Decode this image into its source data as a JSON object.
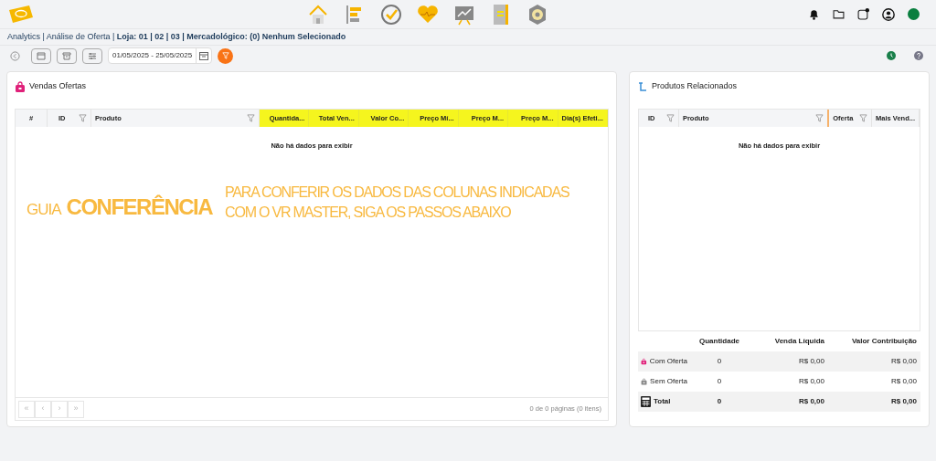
{
  "breadcrumb": "Analytics | Análise de Oferta | **Loja: 01 | 02 | 03 | Mercadológico: (0) Nenhum Selecionado**",
  "toolbar": {
    "date_range": "01/05/2025 - 25/05/2025"
  },
  "sales_panel": {
    "title": "Vendas Ofertas",
    "columns": [
      {
        "label": "#",
        "filter": false,
        "highlighted": false
      },
      {
        "label": "ID",
        "filter": true,
        "highlighted": false
      },
      {
        "label": "Produto",
        "filter": true,
        "highlighted": false
      },
      {
        "label": "Quantida...",
        "filter": false,
        "highlighted": true
      },
      {
        "label": "Total Ven...",
        "filter": false,
        "highlighted": true
      },
      {
        "label": "Valor Co...",
        "filter": false,
        "highlighted": true
      },
      {
        "label": "Preço Mí...",
        "filter": false,
        "highlighted": true
      },
      {
        "label": "Preço M...",
        "filter": false,
        "highlighted": true
      },
      {
        "label": "Preço M...",
        "filter": false,
        "highlighted": true
      },
      {
        "label": "Dia(s) Efeti...",
        "filter": false,
        "highlighted": true
      }
    ],
    "empty_message": "Não há dados para exibir",
    "guide": {
      "small": "GUIA",
      "big": "CONFERÊNCIA",
      "line_1": "PARA CONFERIR  OS DADOS DAS COLUNAS INDICADAS",
      "line_2": "COM O VR MASTER, SIGA OS PASSOS ABAIXO"
    },
    "pager": [
      "«",
      "‹",
      "›",
      "»"
    ],
    "page_info": "0 de 0 páginas (0 itens)"
  },
  "related_panel": {
    "title": "Produtos Relacionados",
    "columns": [
      {
        "label": "ID",
        "filter": true
      },
      {
        "label": "Produto",
        "filter": true
      },
      {
        "label": "Oferta",
        "filter": true
      },
      {
        "label": "Mais Vend...",
        "filter": false
      }
    ],
    "empty_message": "Não há dados para exibir",
    "summary_columns": [
      "Quantidade",
      "Venda Líquida",
      "Valor Contribuição"
    ],
    "summary_rows": [
      {
        "kind": "offer",
        "label": "Com Oferta",
        "values": [
          "0",
          "R$ 0,00",
          "R$ 0,00"
        ]
      },
      {
        "kind": "no-offer",
        "label": "Sem Oferta",
        "values": [
          "0",
          "R$ 0,00",
          "R$ 0,00"
        ]
      },
      {
        "kind": "total",
        "label": "Total",
        "values": [
          "0",
          "R$ 0,00",
          "R$ 0,00"
        ]
      }
    ]
  }
}
